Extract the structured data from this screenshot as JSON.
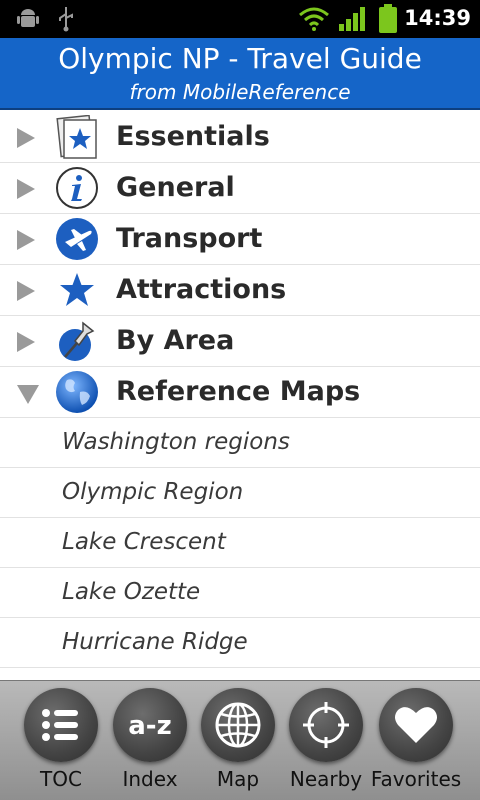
{
  "status_bar": {
    "time": "14:39",
    "icons": [
      "android-debug-icon",
      "usb-icon",
      "wifi-icon",
      "signal-icon",
      "battery-icon"
    ]
  },
  "header": {
    "title": "Olympic NP - Travel Guide",
    "subtitle": "from MobileReference",
    "color": "#1565c8"
  },
  "categories": [
    {
      "label": "Essentials",
      "icon": "essentials-icon",
      "expanded": false
    },
    {
      "label": "General",
      "icon": "info-icon",
      "expanded": false
    },
    {
      "label": "Transport",
      "icon": "airplane-icon",
      "expanded": false
    },
    {
      "label": "Attractions",
      "icon": "star-icon",
      "expanded": false
    },
    {
      "label": "By Area",
      "icon": "pushpin-icon",
      "expanded": false
    },
    {
      "label": "Reference Maps",
      "icon": "globe-icon",
      "expanded": true
    }
  ],
  "reference_maps": [
    "Washington regions",
    "Olympic Region",
    "Lake Crescent",
    "Lake Ozette",
    "Hurricane Ridge"
  ],
  "bottom_tabs": [
    {
      "label": "TOC",
      "icon": "list-icon"
    },
    {
      "label": "Index",
      "icon": "a-z-icon"
    },
    {
      "label": "Map",
      "icon": "globe-grid-icon"
    },
    {
      "label": "Nearby",
      "icon": "crosshair-icon"
    },
    {
      "label": "Favorites",
      "icon": "heart-icon"
    }
  ]
}
